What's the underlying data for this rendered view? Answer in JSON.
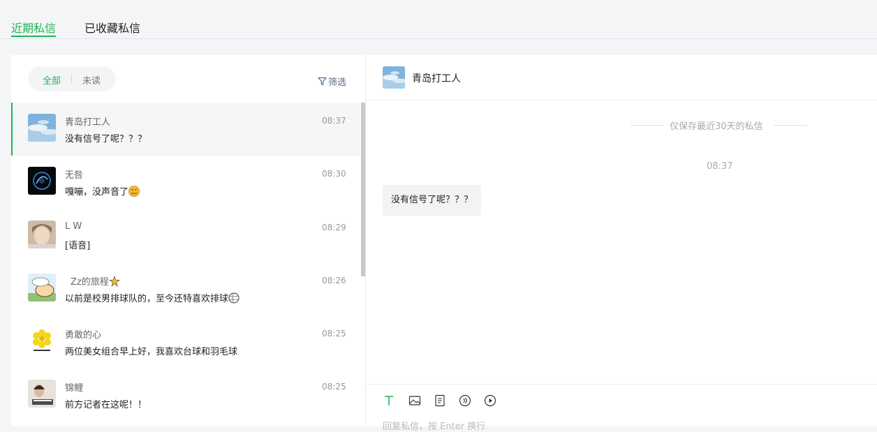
{
  "top_tabs": [
    {
      "label": "近期私信"
    },
    {
      "label": "已收藏私信"
    }
  ],
  "filter": {
    "all_label": "全部",
    "unread_label": "未读",
    "screen_label": "筛选"
  },
  "conversations": [
    {
      "name": "青岛打工人",
      "time": "08:37",
      "message": "没有信号了呢？？？"
    },
    {
      "name": "无咎",
      "time": "08:30",
      "message": "嘎嘣，没声音了"
    },
    {
      "name": "L W",
      "time": "08:29",
      "message": "[语音]"
    },
    {
      "name": "Zz的旅程",
      "time": "08:26",
      "message": "以前是校男排球队的，至今还特喜欢排球"
    },
    {
      "name": "勇敢的心",
      "time": "08:25",
      "message": "两位美女组合早上好，我喜欢台球和羽毛球"
    },
    {
      "name": "锦鲤",
      "time": "08:25",
      "message": "前方记者在这呢！！"
    }
  ],
  "chat": {
    "title": "青岛打工人",
    "notice": "仅保存最近30天的私信",
    "time": "08:37",
    "messages": [
      {
        "text": "没有信号了呢？？？"
      }
    ],
    "composer_placeholder": "回复私信，按 Enter 换行"
  },
  "colors": {
    "accent": "#1db45a"
  }
}
